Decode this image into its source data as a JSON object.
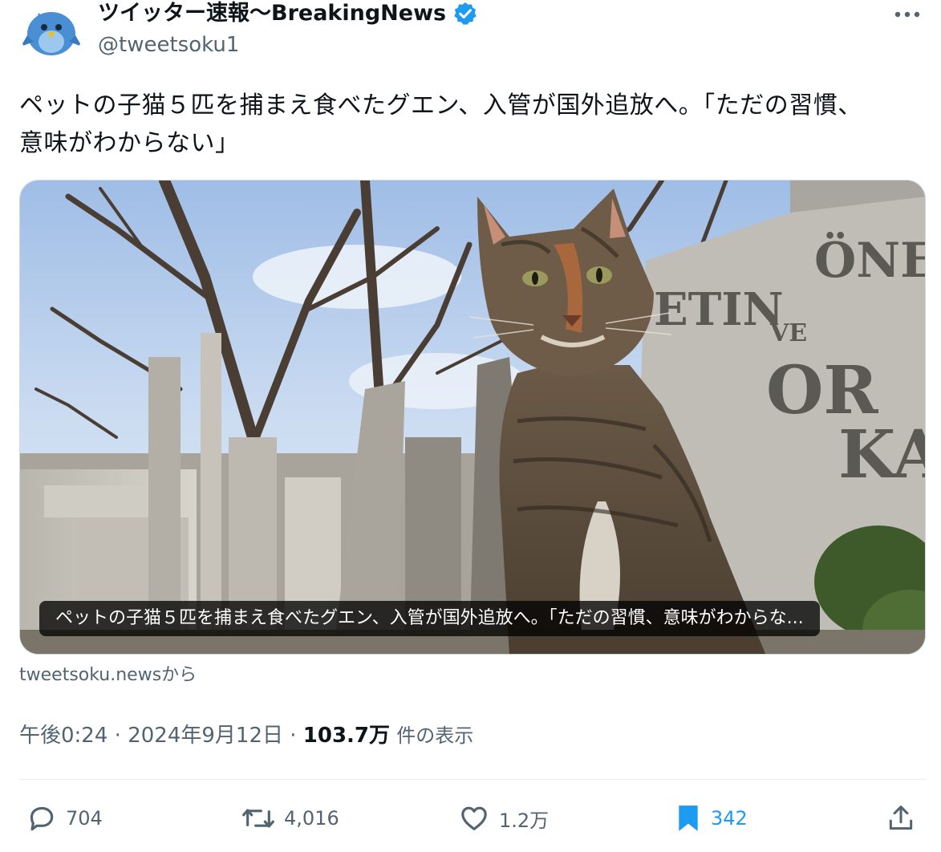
{
  "author": {
    "display_name": "ツイッター速報〜BreakingNews",
    "handle": "@tweetsoku1",
    "verified": true
  },
  "tweet": {
    "text_line1": "ペットの子猫５匹を捕まえ食べたグエン、入管が国外追放へ。「ただの習慣、",
    "text_line2": "意味がわからない」"
  },
  "card": {
    "caption": "ペットの子猫５匹を捕まえ食べたグエン、入管が国外追放へ。「ただの習慣、意味がわからな...",
    "source": "tweetsoku.newsから",
    "image_subject": "tabby cat in a cemetery",
    "gravestone_text": [
      "ETIN",
      "ÖNER",
      "VE",
      "OR",
      "KA"
    ]
  },
  "meta": {
    "time": "午後0:24",
    "separator": "·",
    "date": "2024年9月12日",
    "views": "103.7万",
    "views_label": "件の表示"
  },
  "actions": {
    "replies": "704",
    "reposts": "4,016",
    "likes": "1.2万",
    "bookmarks": "342"
  },
  "colors": {
    "accent": "#1d9bf0",
    "muted": "#536471",
    "text": "#0f1419"
  }
}
